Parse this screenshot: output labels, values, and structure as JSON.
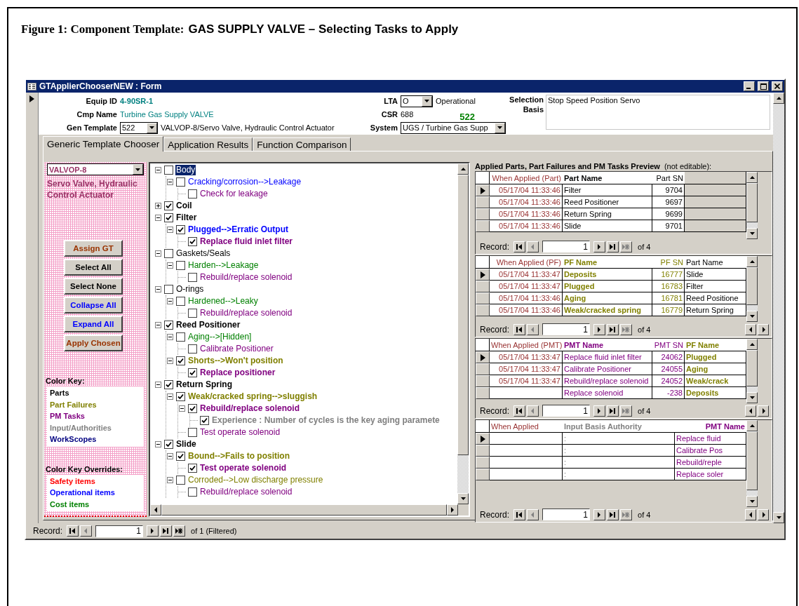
{
  "caption": {
    "label": "Figure 1: Component Template:",
    "title": "GAS SUPPLY VALVE – Selecting Tasks to Apply"
  },
  "window": {
    "title": "GTApplierChooserNEW : Form"
  },
  "header": {
    "equip_id": {
      "label": "Equip ID",
      "value": "4-90SR-1"
    },
    "cmp_name": {
      "label": "Cmp Name",
      "value": "Turbine Gas Supply  VALVE"
    },
    "gen_template": {
      "label": "Gen Template",
      "value": "522",
      "description": "VALVOP-8/Servo Valve, Hydraulic Control Actuator"
    },
    "lta": {
      "label": "LTA",
      "value": "O",
      "description": "Operational"
    },
    "csr": {
      "label": "CSR",
      "value": "688",
      "count": "522"
    },
    "system": {
      "label": "System",
      "value": "UGS / Turbine Gas Supp"
    },
    "selection_basis": {
      "label": "Selection Basis",
      "value": "Stop Speed Position Servo"
    }
  },
  "tabs": [
    {
      "label": "Generic Template Chooser",
      "selected": true
    },
    {
      "label": "Application Results",
      "selected": false
    },
    {
      "label": "Function Comparison",
      "selected": false
    }
  ],
  "template_panel": {
    "combo": "VALVOP-8",
    "description": "Servo Valve, Hydraulic Control Actuator",
    "buttons": [
      {
        "label": "Assign GT",
        "color": "#993300"
      },
      {
        "label": "Select All",
        "color": "#000000"
      },
      {
        "label": "Select None",
        "color": "#000000"
      },
      {
        "label": "Collapse All",
        "color": "#0000ff"
      },
      {
        "label": "Expand All",
        "color": "#0000ff"
      },
      {
        "label": "Apply Chosen",
        "color": "#993300"
      }
    ],
    "color_key": {
      "title": "Color Key:",
      "items": [
        {
          "label": "Parts",
          "color": "#000000"
        },
        {
          "label": "Part Failures",
          "color": "#808000"
        },
        {
          "label": "PM Tasks",
          "color": "#800080"
        },
        {
          "label": "Input/Authorities",
          "color": "#808080"
        },
        {
          "label": "WorkScopes",
          "color": "#000080"
        }
      ]
    },
    "overrides": {
      "title": "Color Key Overrides:",
      "items": [
        {
          "label": "Safety items",
          "color": "#ff0000"
        },
        {
          "label": "Operational items",
          "color": "#0000ff"
        },
        {
          "label": "Cost items",
          "color": "#008000"
        }
      ]
    }
  },
  "tree": [
    {
      "label": "Body",
      "checked": false,
      "selected": true,
      "expanded": true,
      "children": [
        {
          "label": "Cracking/corrosion-->Leakage",
          "checked": false,
          "selected": false,
          "color": "#0000ff",
          "expanded": true,
          "children": [
            {
              "label": "Check for leakage",
              "checked": false,
              "selected": false,
              "color": "#800080"
            }
          ]
        }
      ]
    },
    {
      "label": "Coil",
      "checked": true,
      "selected": false,
      "color": "#000000",
      "expanded": false
    },
    {
      "label": "Filter",
      "checked": true,
      "selected": false,
      "color": "#000000",
      "expanded": true,
      "children": [
        {
          "label": "Plugged-->Erratic  Output",
          "checked": true,
          "selected": false,
          "color": "#0000ff",
          "expanded": true,
          "children": [
            {
              "label": "Replace fluid inlet filter",
              "checked": true,
              "selected": false,
              "color": "#800080"
            }
          ]
        }
      ]
    },
    {
      "label": "Gaskets/Seals",
      "checked": false,
      "selected": false,
      "color": "#000000",
      "expanded": true,
      "children": [
        {
          "label": "Harden-->Leakage",
          "checked": false,
          "selected": false,
          "color": "#008000",
          "expanded": true,
          "children": [
            {
              "label": "Rebuild/replace solenoid",
              "checked": false,
              "selected": false,
              "color": "#800080"
            }
          ]
        }
      ]
    },
    {
      "label": "O-rings",
      "checked": false,
      "selected": false,
      "color": "#000000",
      "expanded": true,
      "children": [
        {
          "label": "Hardened-->Leaky",
          "checked": false,
          "selected": false,
          "color": "#008000",
          "expanded": true,
          "children": [
            {
              "label": "Rebuild/replace solenoid",
              "checked": false,
              "selected": false,
              "color": "#800080"
            }
          ]
        }
      ]
    },
    {
      "label": "Reed Positioner",
      "checked": true,
      "selected": false,
      "color": "#000000",
      "expanded": true,
      "children": [
        {
          "label": "Aging-->[Hidden]",
          "checked": false,
          "selected": false,
          "color": "#008000",
          "expanded": true,
          "children": [
            {
              "label": "Calibrate Positioner",
              "checked": false,
              "selected": false,
              "color": "#800080"
            }
          ]
        },
        {
          "label": "Shorts-->Won't position",
          "checked": true,
          "selected": false,
          "color": "#808000",
          "expanded": true,
          "children": [
            {
              "label": "Replace positioner",
              "checked": true,
              "selected": false,
              "color": "#800080"
            }
          ]
        }
      ]
    },
    {
      "label": "Return Spring",
      "checked": true,
      "selected": false,
      "color": "#000000",
      "expanded": true,
      "children": [
        {
          "label": "Weak/cracked spring-->sluggish",
          "checked": true,
          "selected": false,
          "color": "#808000",
          "expanded": true,
          "children": [
            {
              "label": "Rebuild/replace solenoid",
              "checked": true,
              "selected": false,
              "color": "#800080",
              "expanded": true,
              "children": [
                {
                  "label": "Experience : Number of cycles is the key aging paramete",
                  "checked": true,
                  "selected": false,
                  "color": "#808080"
                }
              ]
            },
            {
              "label": "Test operate solenoid",
              "checked": false,
              "selected": false,
              "color": "#800080"
            }
          ]
        }
      ]
    },
    {
      "label": "Slide",
      "checked": true,
      "selected": false,
      "color": "#000000",
      "expanded": true,
      "children": [
        {
          "label": "Bound-->Fails to position",
          "checked": true,
          "selected": false,
          "color": "#808000",
          "expanded": true,
          "children": [
            {
              "label": "Test operate solenoid",
              "checked": true,
              "selected": false,
              "color": "#800080"
            }
          ]
        },
        {
          "label": "Corroded-->Low discharge pressure",
          "checked": false,
          "selected": false,
          "color": "#808000",
          "expanded": true,
          "children": [
            {
              "label": "Rebuild/replace solenoid",
              "checked": false,
              "selected": false,
              "color": "#800080"
            }
          ]
        }
      ]
    }
  ],
  "preview": {
    "title": "Applied Parts, Part Failures and PM Tasks Preview",
    "note": "(not editable):",
    "tables": [
      {
        "columns": [
          {
            "label": "When Applied (Part)",
            "kind": "date",
            "color": "#993333",
            "header_bold": false
          },
          {
            "label": "Part Name",
            "kind": "text",
            "color": "#000000",
            "header_bold": true
          },
          {
            "label": "Part SN",
            "kind": "number",
            "color": "#000000",
            "header_bold": false
          }
        ],
        "rows": [
          {
            "selected": true,
            "cells": [
              "05/17/04 11:33:46",
              "Filter",
              "9704"
            ]
          },
          {
            "selected": false,
            "cells": [
              "05/17/04 11:33:46",
              "Reed Positioner",
              "9697"
            ]
          },
          {
            "selected": false,
            "cells": [
              "05/17/04 11:33:46",
              "Return Spring",
              "9699"
            ]
          },
          {
            "selected": false,
            "cells": [
              "05/17/04 11:33:46",
              "Slide",
              "9701"
            ]
          }
        ],
        "navigator": {
          "label": "Record:",
          "value": "1",
          "count": "of  4",
          "new_disabled": true
        }
      },
      {
        "columns": [
          {
            "label": "When Applied (PF)",
            "kind": "date",
            "color": "#993333",
            "header_bold": false
          },
          {
            "label": "PF Name",
            "kind": "failure",
            "color": "#808000",
            "header_bold": true
          },
          {
            "label": "PF SN",
            "kind": "number",
            "color": "#808000",
            "header_bold": false
          },
          {
            "label": "Part Name",
            "kind": "text",
            "color": "#000000",
            "header_bold": false
          }
        ],
        "rows": [
          {
            "selected": true,
            "cells": [
              "05/17/04 11:33:47",
              "Deposits",
              "16777",
              "Slide"
            ]
          },
          {
            "selected": false,
            "cells": [
              "05/17/04 11:33:47",
              "Plugged",
              "16783",
              "Filter"
            ]
          },
          {
            "selected": false,
            "cells": [
              "05/17/04 11:33:46",
              "Aging",
              "16781",
              "Reed Positione"
            ]
          },
          {
            "selected": false,
            "cells": [
              "05/17/04 11:33:46",
              "Weak/cracked spring",
              "16779",
              "Return Spring"
            ]
          }
        ],
        "navigator": {
          "label": "Record:",
          "value": "1",
          "count": "of  4",
          "new_disabled": true
        }
      },
      {
        "columns": [
          {
            "label": "When Applied (PMT)",
            "kind": "date",
            "color": "#993333",
            "header_bold": false
          },
          {
            "label": "PMT Name",
            "kind": "text",
            "color": "#800080",
            "header_bold": true
          },
          {
            "label": "PMT SN",
            "kind": "number",
            "color": "#800080",
            "header_bold": false
          },
          {
            "label": "PF Name",
            "kind": "failure",
            "color": "#808000",
            "header_bold": true
          }
        ],
        "rows": [
          {
            "selected": true,
            "cells": [
              "05/17/04 11:33:47",
              "Replace fluid inlet filter",
              "24062",
              "Plugged"
            ]
          },
          {
            "selected": false,
            "cells": [
              "05/17/04 11:33:47",
              "Calibrate Positioner",
              "24055",
              "Aging"
            ]
          },
          {
            "selected": false,
            "cells": [
              "05/17/04 11:33:47",
              "Rebuild/replace solenoid",
              "24052",
              "Weak/crack"
            ]
          },
          {
            "selected": false,
            "cells": [
              null,
              "Replace solenoid",
              "-238",
              "Deposits"
            ]
          }
        ],
        "navigator": {
          "label": "Record:",
          "value": "1",
          "count": "of  4",
          "new_disabled": true
        }
      },
      {
        "columns": [
          {
            "label": "When Applied",
            "kind": "text",
            "color": "#993333",
            "header_bold": false
          },
          {
            "label": "Input Basis Authority",
            "kind": "text",
            "color": "#808080",
            "header_bold": true
          },
          {
            "label": "PMT Name",
            "kind": "name",
            "color": "#800080",
            "header_bold": true
          }
        ],
        "rows": [
          {
            "selected": true,
            "cells": [
              null,
              ":",
              "Replace fluid"
            ]
          },
          {
            "selected": false,
            "cells": [
              null,
              ":",
              "Calibrate Pos"
            ]
          },
          {
            "selected": false,
            "cells": [
              null,
              ":",
              "Rebuild/reple"
            ]
          },
          {
            "selected": false,
            "cells": [
              null,
              ":",
              "Replace soler"
            ]
          }
        ],
        "navigator": {
          "label": "Record:",
          "value": "1",
          "count": "of  4",
          "new_disabled": true
        }
      }
    ]
  },
  "navigator": {
    "label": "Record:",
    "value": "1",
    "count": "of  1 (Filtered)",
    "new_disabled": false
  }
}
